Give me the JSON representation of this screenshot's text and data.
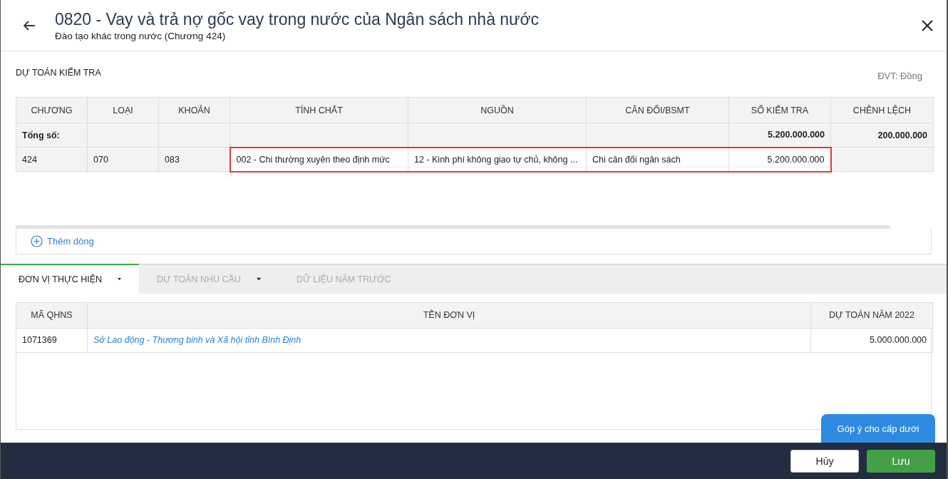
{
  "header": {
    "title": "0820 - Vay và trả nợ gốc vay trong nước của Ngân sách nhà nước",
    "subtitle": "Đào tạo khác trong nước (Chương 424)"
  },
  "check_section": {
    "title": "DỰ TOÁN KIỂM TRA",
    "unit": "ĐVT: Đồng"
  },
  "check_table": {
    "columns": [
      "CHƯƠNG",
      "LOẠI",
      "KHOẢN",
      "TÍNH CHẤT",
      "NGUỒN",
      "CÂN ĐỐI/BSMT",
      "SỐ KIỂM TRA",
      "CHÊNH LỆCH"
    ],
    "rows": [
      {
        "kind": "total",
        "cells": [
          {
            "text": "Tổng số:",
            "editable": false
          },
          {
            "text": "",
            "editable": false
          },
          {
            "text": "",
            "editable": false
          },
          {
            "text": "",
            "editable": false
          },
          {
            "text": "",
            "editable": false
          },
          {
            "text": "",
            "editable": false
          },
          {
            "text": "5.200.000.000",
            "editable": false
          },
          {
            "text": "200.000.000",
            "editable": false
          }
        ]
      },
      {
        "kind": "data",
        "cells": [
          {
            "text": "424",
            "editable": false
          },
          {
            "text": "070",
            "editable": false
          },
          {
            "text": "083",
            "editable": false
          },
          {
            "text": "002 - Chi thường xuyên theo định mức",
            "editable": true
          },
          {
            "text": "12 - Kinh phí không giao tự chủ, không ...",
            "editable": true
          },
          {
            "text": "Chi cân đối ngân sách",
            "editable": true
          },
          {
            "text": "5.200.000.000",
            "editable": true
          },
          {
            "text": "",
            "editable": false
          }
        ]
      }
    ]
  },
  "add_row": {
    "label": "Thêm dòng"
  },
  "tabs": [
    {
      "label": "ĐƠN VỊ THỰC HIỆN",
      "selected": true
    },
    {
      "label": "DỰ TOÁN NHU CẦU",
      "selected": false
    },
    {
      "label": "DỮ LIỆU NĂM TRƯỚC",
      "selected": false
    }
  ],
  "unit_table": {
    "columns": [
      "MÃ QHNS",
      "TÊN ĐƠN VỊ",
      "DỰ TOÁN NĂM 2022"
    ],
    "rows": [
      {
        "code": "1071369",
        "name": "Sở Lao động - Thương binh và Xã hội tỉnh Bình Định",
        "amount": "5.000.000.000"
      }
    ]
  },
  "feedback_button": {
    "label": "Góp ý cho cấp dưới"
  },
  "footer": {
    "buttons": [
      {
        "label": "Hủy",
        "kind": "secondary"
      },
      {
        "label": "Lưu",
        "kind": "primary"
      }
    ]
  }
}
